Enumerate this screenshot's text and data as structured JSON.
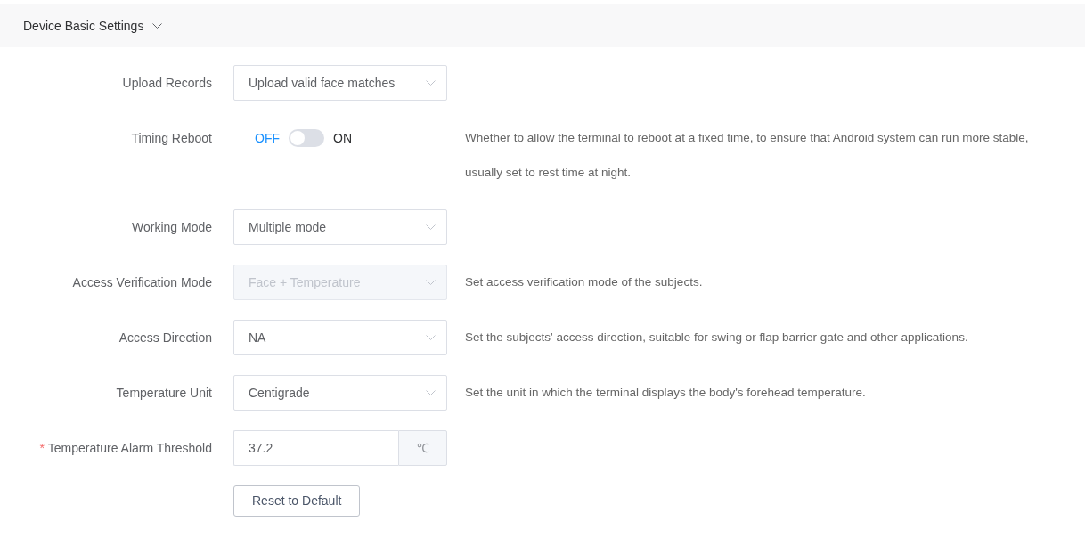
{
  "section": {
    "title": "Device Basic Settings",
    "expanded": true
  },
  "rows": [
    {
      "kind": "select",
      "label": "Upload Records",
      "value": "Upload valid face matches",
      "disabled": false
    },
    {
      "kind": "switch",
      "label": "Timing Reboot",
      "off_label": "OFF",
      "on_label": "ON",
      "on": false,
      "help": "Whether to allow the terminal to reboot at a fixed time, to ensure that Android system can run more stable, usually set to rest time at night."
    },
    {
      "kind": "select",
      "label": "Working Mode",
      "value": "Multiple mode",
      "disabled": false
    },
    {
      "kind": "select",
      "label": "Access Verification Mode",
      "value": "Face + Temperature",
      "disabled": true,
      "help": "Set access verification mode of the subjects."
    },
    {
      "kind": "select",
      "label": "Access Direction",
      "value": "NA",
      "disabled": false,
      "help": "Set the subjects' access direction, suitable for swing or flap barrier gate and other applications."
    },
    {
      "kind": "select",
      "label": "Temperature Unit",
      "value": "Centigrade",
      "disabled": false,
      "help": "Set the unit in which the terminal displays the body's forehead temperature."
    },
    {
      "kind": "input",
      "label": "Temperature Alarm Threshold",
      "value": "37.2",
      "unit": "℃",
      "required_mark": "*"
    }
  ],
  "reset_button": "Reset to Default"
}
